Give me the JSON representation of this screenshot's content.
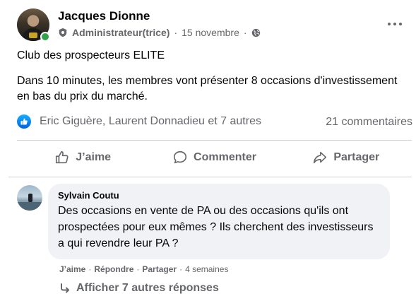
{
  "post": {
    "author": "Jacques Dionne",
    "role": "Administrateur(trice)",
    "date": "15 novembre",
    "separator": "·",
    "title": "Club des prospecteurs ELITE",
    "body": "Dans 10 minutes, les membres vont présenter 8 occasions d'investissement en bas du prix du marché.",
    "reactors": "Eric Giguère, Laurent Donnadieu et 7 autres",
    "comments_count": "21 commentaires"
  },
  "actions": {
    "like": "J’aime",
    "comment": "Commenter",
    "share": "Partager"
  },
  "comment": {
    "author": "Sylvain Coutu",
    "text": "Des occasions en vente de PA ou des occasions qu'ils ont prospectées pour eux mêmes ? Ils cherchent des investisseurs a qui revendre leur PA ?",
    "like": "J’aime",
    "reply": "Répondre",
    "share": "Partager",
    "time": "4 semaines",
    "separator": "·"
  },
  "more_replies": "Afficher 7 autres réponses",
  "colors": {
    "accent_blue": "#1877f2",
    "online_green": "#31a24c",
    "muted_text": "#65676b",
    "bubble_bg": "#f0f2f5"
  },
  "icons": [
    "admin-badge-icon",
    "globe-icon",
    "more-options-icon",
    "like-reaction-icon",
    "thumbs-up-icon",
    "comment-icon",
    "share-icon",
    "reply-arrow-icon"
  ]
}
